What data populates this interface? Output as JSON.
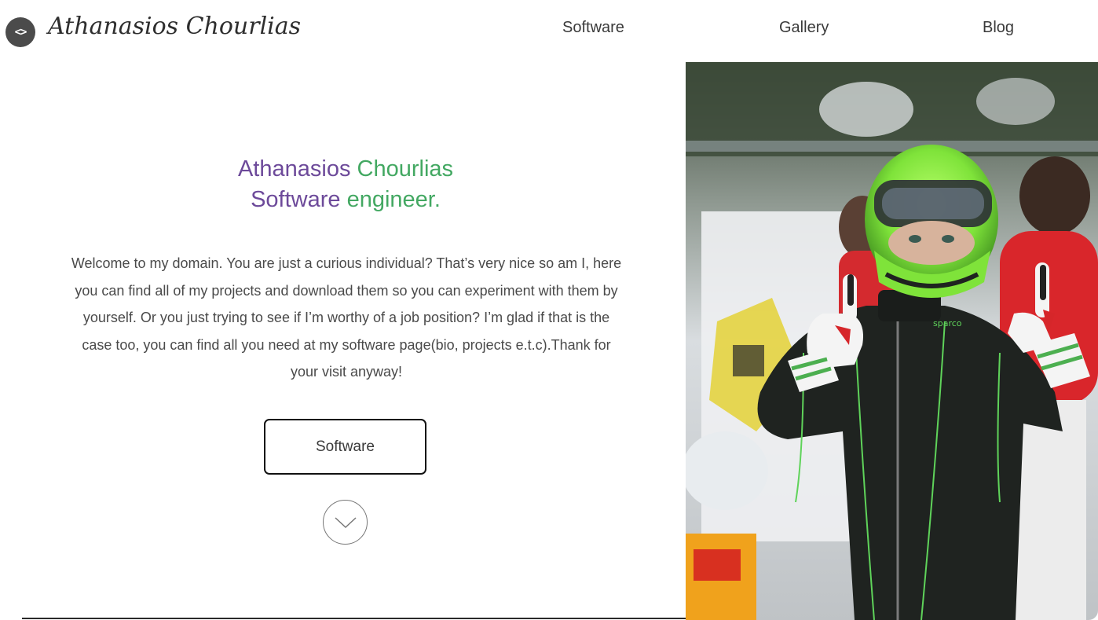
{
  "header": {
    "logo_glyph": "<>",
    "brand_name": "Athanasios Chourlias",
    "nav": [
      {
        "label": "Software"
      },
      {
        "label": "Gallery"
      },
      {
        "label": "Blog"
      }
    ]
  },
  "hero": {
    "title_part1": "Athanasios",
    "title_part2": "Chourlias",
    "subtitle_part1": "Software",
    "subtitle_part2": "engineer.",
    "intro": "Welcome to my domain. You are just a curious individual? That’s very nice so am I, here you can find all of my projects and download them so you can experiment with them by yourself. Or you just trying to see if I’m worthy of a job position? I’m glad if that is the case too, you can find all you need at my software page(bio, projects e.t.c).Thank for your visit anyway!",
    "cta_label": "Software",
    "scroll_icon": "chevron-down-icon"
  },
  "photo": {
    "description_icon": "driver-photo",
    "suit_brand": "sparco",
    "helmet_color": "#7fe33a",
    "suit_color": "#1f2320",
    "accent_green": "#5fd35a"
  },
  "colors": {
    "purple": "#6d4a9a",
    "green": "#43a862",
    "text": "#4a4a4a"
  }
}
